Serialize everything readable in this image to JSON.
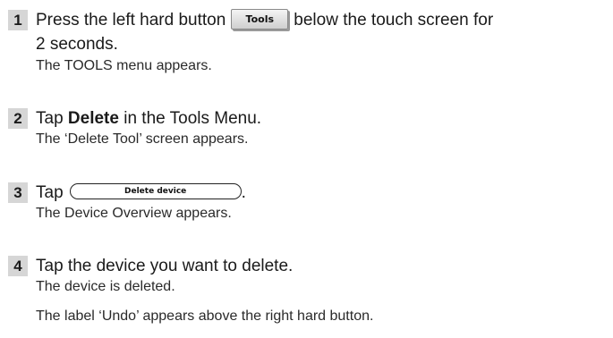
{
  "steps": [
    {
      "number": "1",
      "line1_before": "Press the left hard button",
      "button_label": "Tools",
      "line1_after": "below the touch screen for",
      "line2": "2 seconds.",
      "result": "The TOOLS menu appears."
    },
    {
      "number": "2",
      "before": "Tap ",
      "bold": "Delete",
      "after": " in the Tools Menu.",
      "result": "The ‘Delete Tool’ screen appears."
    },
    {
      "number": "3",
      "before": "Tap",
      "button_label": "Delete device",
      "after": ".",
      "result": "The Device Overview appears."
    },
    {
      "number": "4",
      "text": "Tap the device you want to delete.",
      "result": "The device is deleted.",
      "note": "The label ‘Undo’ appears above the right hard button."
    }
  ]
}
